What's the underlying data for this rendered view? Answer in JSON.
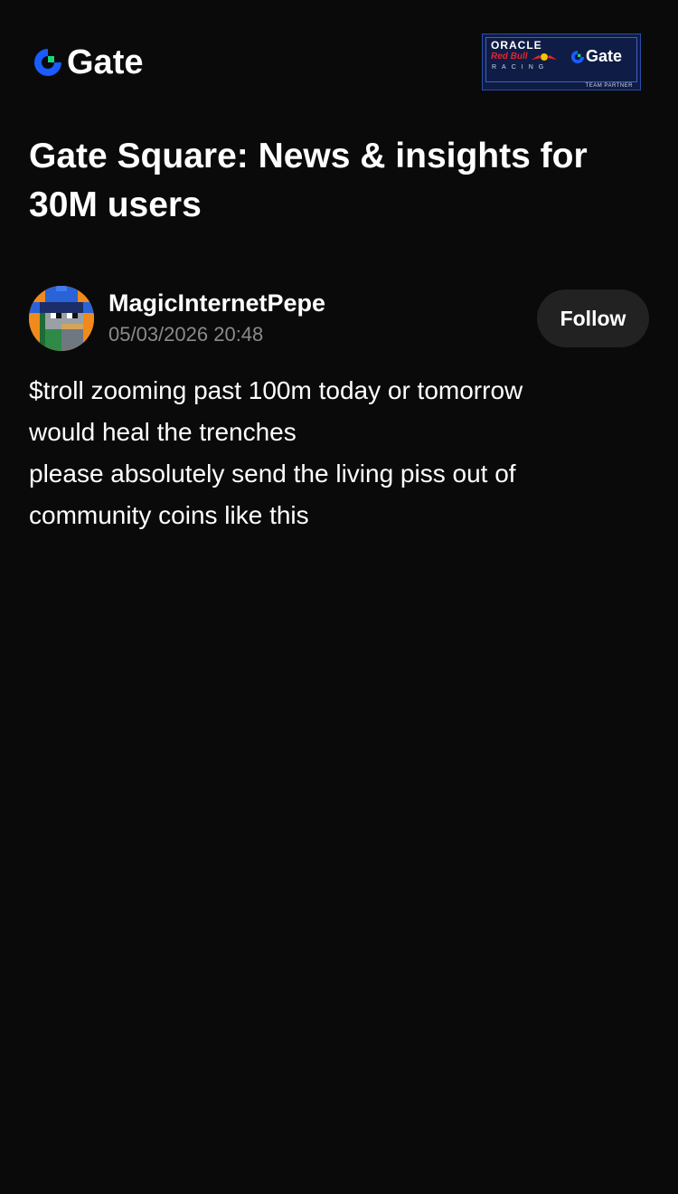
{
  "header": {
    "brand_name": "Gate",
    "partner_badge": {
      "line1": "ORACLE",
      "line2": "Red Bull",
      "line3": "RACING",
      "brand": "Gate",
      "tag": "TEAM PARTNER"
    }
  },
  "page": {
    "title": "Gate Square: News & insights for 30M users"
  },
  "post": {
    "author": {
      "name": "MagicInternetPepe",
      "timestamp": "05/03/2026 20:48"
    },
    "follow_label": "Follow",
    "body_lines": [
      "$troll zooming past 100m today or tomorrow",
      "would heal the trenches",
      "please absolutely send the living piss out of",
      "community coins like this"
    ]
  },
  "colors": {
    "background": "#0a0a0a",
    "brand_blue": "#1a5cff",
    "brand_green": "#19d57c",
    "muted_text": "#8a8a8a",
    "button_bg": "#222222"
  },
  "icons": {
    "brand_logo": "gate-logo-icon",
    "avatar": "pixel-art-avatar"
  }
}
